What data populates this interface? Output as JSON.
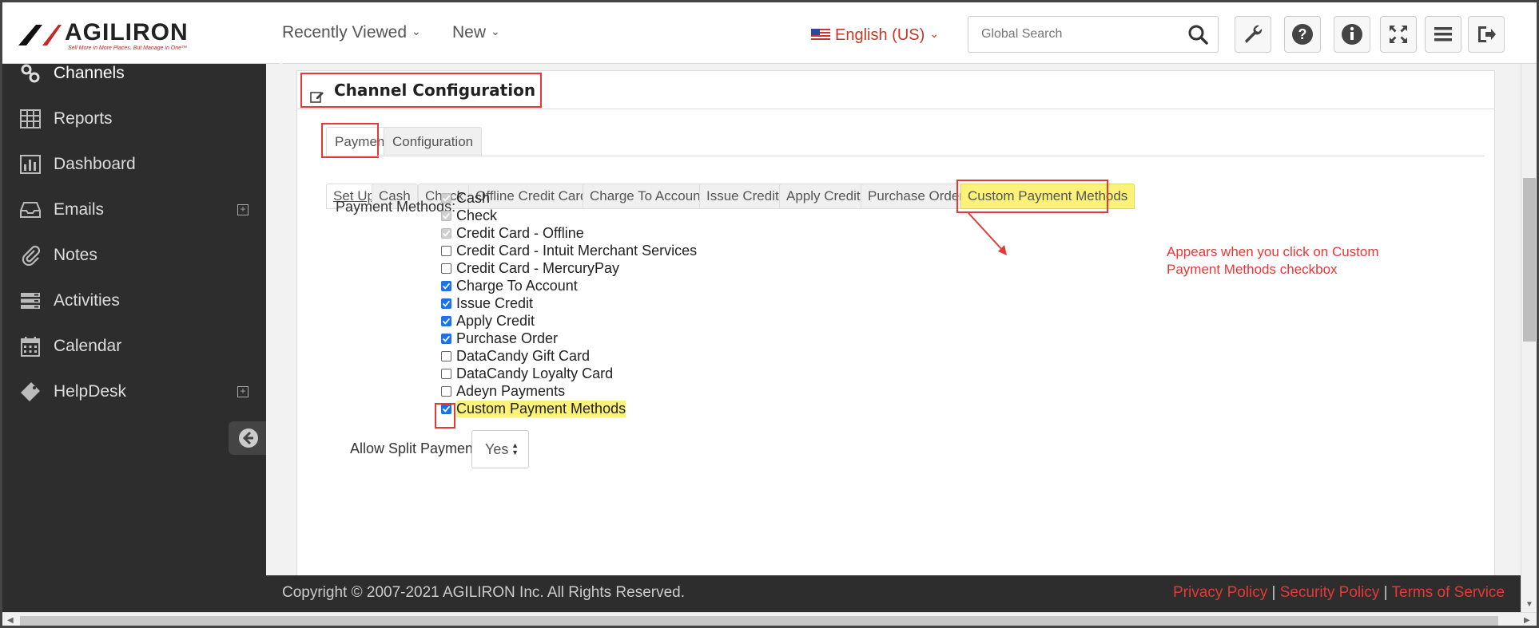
{
  "brand": {
    "name": "AGILIRON",
    "tagline": "Sell More in More Places. But Manage in One™"
  },
  "topnav": {
    "recently_viewed": "Recently Viewed",
    "new": "New",
    "language": "English (US)",
    "search_placeholder": "Global Search"
  },
  "sidebar": {
    "items": [
      {
        "label": "Channels"
      },
      {
        "label": "Reports"
      },
      {
        "label": "Dashboard"
      },
      {
        "label": "Emails"
      },
      {
        "label": "Notes"
      },
      {
        "label": "Activities"
      },
      {
        "label": "Calendar"
      },
      {
        "label": "HelpDesk"
      }
    ]
  },
  "panel": {
    "title": "Channel Configuration",
    "tabs": [
      {
        "label": "Payment"
      },
      {
        "label": "Configuration"
      }
    ],
    "subtabs": [
      {
        "label": "Set Up"
      },
      {
        "label": "Cash"
      },
      {
        "label": "Check"
      },
      {
        "label": "Offline Credit Card"
      },
      {
        "label": "Charge To Account"
      },
      {
        "label": "Issue Credit"
      },
      {
        "label": "Apply Credit"
      },
      {
        "label": "Purchase Order"
      },
      {
        "label": "Custom Payment Methods"
      }
    ],
    "payment_methods_label": "Payment Methods:",
    "payment_methods": [
      {
        "label": "Cash",
        "checked": true,
        "disabled": true
      },
      {
        "label": "Check",
        "checked": true,
        "disabled": true
      },
      {
        "label": "Credit Card - Offline",
        "checked": true,
        "disabled": true
      },
      {
        "label": "Credit Card - Intuit Merchant Services",
        "checked": false,
        "disabled": false
      },
      {
        "label": "Credit Card - MercuryPay",
        "checked": false,
        "disabled": false
      },
      {
        "label": "Charge To Account",
        "checked": true,
        "disabled": false
      },
      {
        "label": "Issue Credit",
        "checked": true,
        "disabled": false
      },
      {
        "label": "Apply Credit",
        "checked": true,
        "disabled": false
      },
      {
        "label": "Purchase Order",
        "checked": true,
        "disabled": false
      },
      {
        "label": "DataCandy Gift Card",
        "checked": false,
        "disabled": false
      },
      {
        "label": "DataCandy Loyalty Card",
        "checked": false,
        "disabled": false
      },
      {
        "label": "Adeyn Payments",
        "checked": false,
        "disabled": false
      },
      {
        "label": "Custom Payment Methods",
        "checked": true,
        "disabled": false
      }
    ],
    "split_label": "Allow Split Payments:",
    "split_value": "Yes",
    "annotation": "Appears when you click on Custom Payment Methods checkbox"
  },
  "footer": {
    "copyright": "Copyright © 2007-2021 AGILIRON Inc. All Rights Reserved.",
    "privacy": "Privacy Policy",
    "security": "Security Policy",
    "terms": "Terms of Service",
    "separator": "|"
  },
  "colors": {
    "accent_red": "#e53935",
    "sidebar_bg": "#2d2d2d",
    "highlight": "#fbf277",
    "check_blue": "#1a73e8"
  }
}
